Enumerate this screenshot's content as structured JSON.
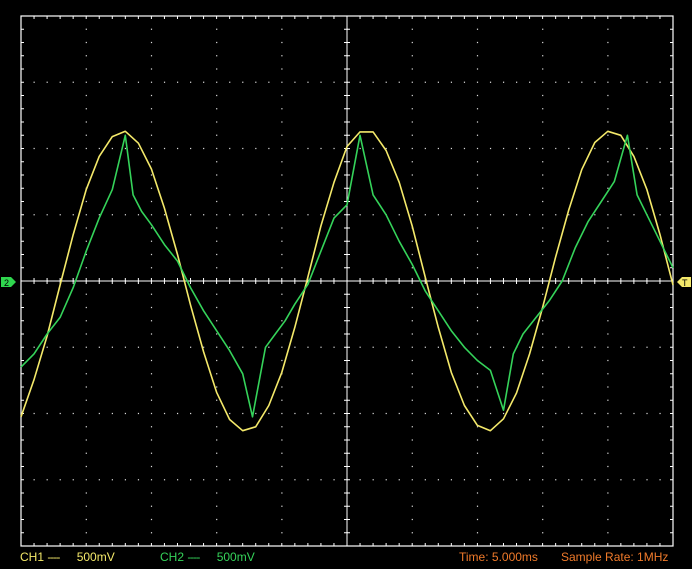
{
  "markers": {
    "left": "2",
    "right": "T"
  },
  "status": {
    "ch1": {
      "label": "CH1",
      "coupling": "----",
      "scale": "500mV"
    },
    "ch2": {
      "label": "CH2",
      "coupling": "----",
      "scale": "500mV"
    },
    "time": "Time: 5.000ms",
    "sample_rate": "Sample Rate: 1MHz"
  },
  "colors": {
    "background": "#000000",
    "grid": "#ffffff",
    "ch1": "#f4e96a",
    "ch2": "#35d35a",
    "status_time": "#f07a2a"
  },
  "chart_data": {
    "type": "line",
    "title": "",
    "xlabel": "",
    "ylabel": "",
    "grid": true,
    "x_divisions": 10,
    "y_divisions": 8,
    "xlim": [
      0,
      10
    ],
    "ylim": [
      -4,
      4
    ],
    "series": [
      {
        "name": "CH1",
        "color": "#f4e96a",
        "period_div": 4.1,
        "amplitude_div": 2.25,
        "x": [
          0.0,
          0.2,
          0.4,
          0.6,
          0.8,
          1.0,
          1.2,
          1.4,
          1.6,
          1.8,
          2.0,
          2.2,
          2.4,
          2.6,
          2.8,
          3.0,
          3.2,
          3.4,
          3.6,
          3.8,
          4.0,
          4.2,
          4.4,
          4.6,
          4.8,
          5.0,
          5.2,
          5.4,
          5.6,
          5.8,
          6.0,
          6.2,
          6.4,
          6.6,
          6.8,
          7.0,
          7.2,
          7.4,
          7.6,
          7.8,
          8.0,
          8.2,
          8.4,
          8.6,
          8.8,
          9.0,
          9.2,
          9.4,
          9.6,
          9.8,
          10.0
        ],
        "y": [
          -2.05,
          -1.49,
          -0.83,
          -0.06,
          0.7,
          1.38,
          1.88,
          2.18,
          2.26,
          2.08,
          1.69,
          1.1,
          0.4,
          -0.36,
          -1.07,
          -1.68,
          -2.09,
          -2.26,
          -2.2,
          -1.88,
          -1.38,
          -0.7,
          0.06,
          0.83,
          1.49,
          2.03,
          2.25,
          2.25,
          1.97,
          1.49,
          0.83,
          0.06,
          -0.7,
          -1.38,
          -1.88,
          -2.18,
          -2.26,
          -2.08,
          -1.69,
          -1.1,
          -0.4,
          0.36,
          1.07,
          1.68,
          2.09,
          2.26,
          2.2,
          1.88,
          1.38,
          0.7,
          -0.06
        ]
      },
      {
        "name": "CH2",
        "color": "#35d35a",
        "x": [
          0.0,
          0.2,
          0.4,
          0.6,
          0.8,
          1.0,
          1.2,
          1.4,
          1.6,
          1.72,
          1.85,
          2.0,
          2.2,
          2.4,
          2.6,
          2.8,
          3.0,
          3.2,
          3.4,
          3.55,
          3.75,
          3.9,
          4.05,
          4.2,
          4.4,
          4.6,
          4.8,
          5.0,
          5.2,
          5.4,
          5.6,
          5.8,
          6.0,
          6.2,
          6.4,
          6.6,
          6.8,
          7.0,
          7.2,
          7.4,
          7.55,
          7.7,
          7.9,
          8.1,
          8.3,
          8.5,
          8.7,
          8.9,
          9.1,
          9.3,
          9.45,
          9.6,
          9.8,
          10.0
        ],
        "y": [
          -1.3,
          -1.1,
          -0.8,
          -0.55,
          -0.1,
          0.45,
          0.95,
          1.38,
          2.2,
          1.3,
          1.05,
          0.85,
          0.55,
          0.3,
          -0.1,
          -0.45,
          -0.75,
          -1.05,
          -1.4,
          -2.05,
          -1.0,
          -0.8,
          -0.6,
          -0.35,
          -0.05,
          0.45,
          0.95,
          1.15,
          2.2,
          1.3,
          1.0,
          0.6,
          0.25,
          -0.15,
          -0.45,
          -0.75,
          -1.0,
          -1.2,
          -1.35,
          -1.95,
          -1.1,
          -0.8,
          -0.55,
          -0.3,
          0.0,
          0.5,
          0.9,
          1.2,
          1.5,
          2.2,
          1.3,
          1.0,
          0.6,
          0.2
        ]
      }
    ]
  }
}
